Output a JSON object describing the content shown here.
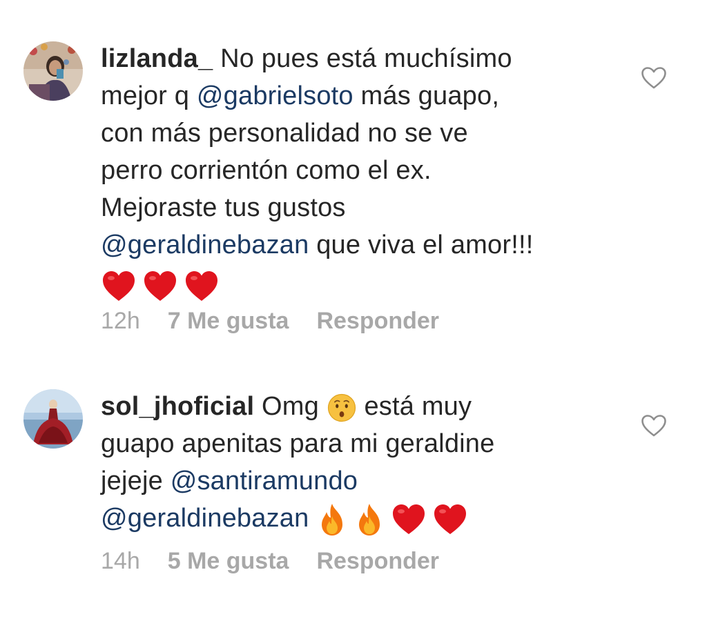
{
  "comments": [
    {
      "username": "lizlanda_",
      "lines": [
        [
          {
            "t": "txt",
            "v": " No pues está muchísimo"
          }
        ],
        [
          {
            "t": "txt",
            "v": "mejor q "
          },
          {
            "t": "mention",
            "v": "@gabrielsoto"
          },
          {
            "t": "txt",
            "v": " más guapo,"
          }
        ],
        [
          {
            "t": "txt",
            "v": "con más personalidad no se ve"
          }
        ],
        [
          {
            "t": "txt",
            "v": "perro corrientón como el ex."
          }
        ],
        [
          {
            "t": "txt",
            "v": "Mejoraste tus gustos"
          }
        ],
        [
          {
            "t": "mention",
            "v": "@geraldinebazan"
          },
          {
            "t": "txt",
            "v": " que viva el amor!!!"
          }
        ]
      ],
      "emojis": [
        "red-heart",
        "red-heart",
        "red-heart"
      ],
      "time": "12h",
      "likes": "7 Me gusta",
      "reply": "Responder"
    },
    {
      "username": "sol_jhoficial",
      "time": "14h",
      "likes": "5 Me gusta",
      "reply": "Responder",
      "text_omg": " Omg ",
      "text_esta_muy": " está muy",
      "line2": "guapo apenitas para mi geraldine",
      "line3_text": "jejeje ",
      "line3_mention": "@santiramundo",
      "line4_mention": "@geraldinebazan",
      "line4_emojis": [
        "fire",
        "fire",
        "red-heart",
        "red-heart"
      ]
    }
  ],
  "colors": {
    "text": "#262626",
    "mention": "#1b3a63",
    "meta": "#a8a8a8",
    "heart_red": "#e0141e"
  }
}
